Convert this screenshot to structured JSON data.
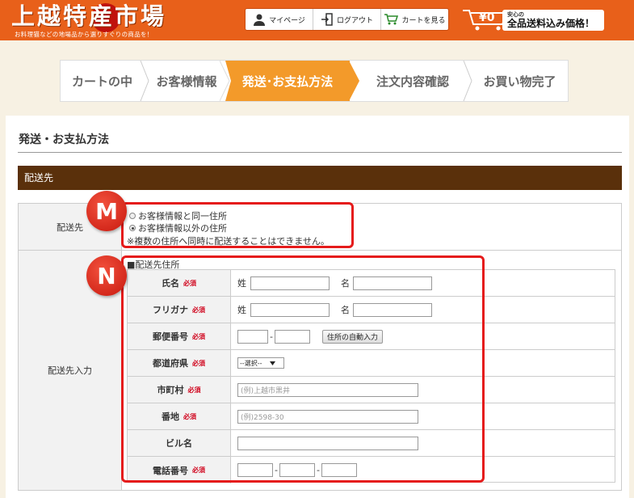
{
  "header": {
    "logo_text": "上越特産市場",
    "logo_tagline": "お料理猫などの地場品から選りすぐりの商品を！",
    "mypage_label": "マイページ",
    "logout_label": "ログアウト",
    "cart_label": "カートを見る",
    "cart_total": "¥0",
    "shipping_small": "安心の",
    "shipping_big": "全品送料込み価格！"
  },
  "steps": [
    {
      "label": "カートの中"
    },
    {
      "label": "お客様情報"
    },
    {
      "label": "発送･お支払方法"
    },
    {
      "label": "注文内容確認"
    },
    {
      "label": "お買い物完了"
    }
  ],
  "page": {
    "title": "発送・お支払方法",
    "section": "配送先"
  },
  "delivery": {
    "label": "配送先",
    "option_same": "お客様情報と同一住所",
    "option_other": "お客様情報以外の住所",
    "note": "※複数の住所へ同時に配送することはできません。"
  },
  "address": {
    "label": "配送先入力",
    "heading": "■配送先住所",
    "required": "必須",
    "name_label": "氏名",
    "kana_label": "フリガナ",
    "sei": "姓",
    "mei": "名",
    "postal_label": "郵便番号",
    "postal_dash": "-",
    "auto_button": "住所の自動入力",
    "pref_label": "都道府県",
    "pref_select": "--選択--",
    "city_label": "市町村",
    "city_placeholder": "(例)上越市黒井",
    "banchi_label": "番地",
    "banchi_placeholder": "(例)2598-30",
    "building_label": "ビル名",
    "phone_label": "電話番号",
    "phone_dash": "-"
  },
  "annotations": {
    "m": "M",
    "n": "N"
  },
  "colors": {
    "header_orange": "#e8601a",
    "step_active": "#f39a2a",
    "section_brown": "#5a300b",
    "highlight_red": "#e51b1b",
    "required_red": "#d0021b"
  }
}
